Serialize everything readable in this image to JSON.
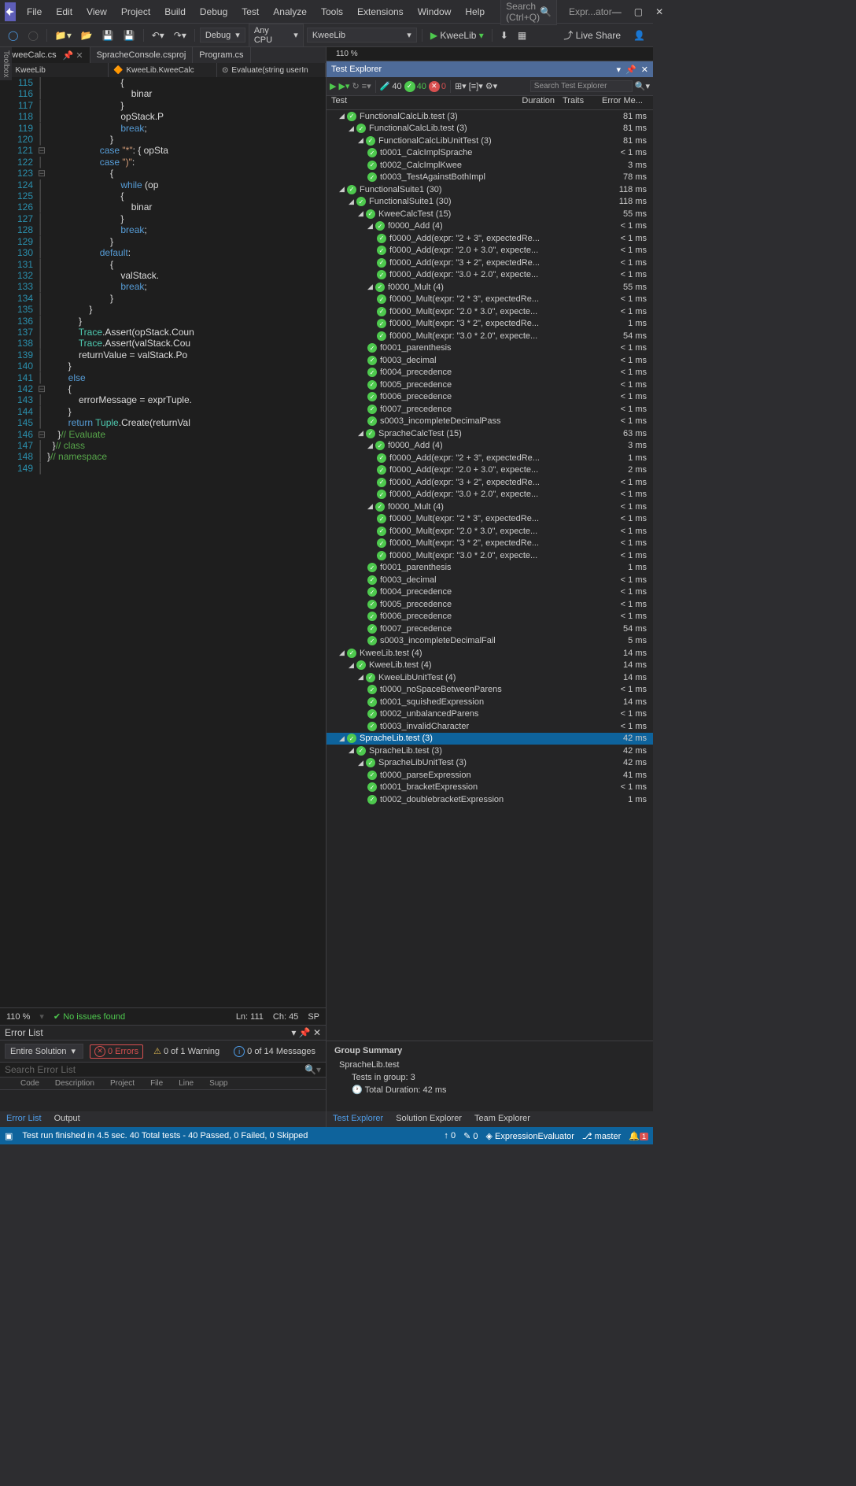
{
  "menu": [
    "File",
    "Edit",
    "View",
    "Project",
    "Build",
    "Debug",
    "Test",
    "Analyze",
    "Tools",
    "Extensions",
    "Window",
    "Help"
  ],
  "searchPlaceholder": "Search (Ctrl+Q)",
  "windowTitle": "Expr...ator",
  "toolbar": {
    "config": "Debug",
    "platform": "Any CPU",
    "project": "KweeLib",
    "run": "KweeLib",
    "liveShare": "Live Share"
  },
  "tabs": [
    {
      "label": "KweeCalc.cs",
      "active": true
    },
    {
      "label": "SpracheConsole.csproj",
      "active": false
    },
    {
      "label": "Program.cs",
      "active": false
    }
  ],
  "nav": {
    "ns": "KweeLib",
    "cls": "KweeLib.KweeCalc",
    "mth": "Evaluate(string userIn"
  },
  "lines": [
    115,
    116,
    117,
    118,
    119,
    120,
    121,
    122,
    123,
    124,
    125,
    126,
    127,
    128,
    129,
    130,
    131,
    132,
    133,
    134,
    135,
    136,
    137,
    138,
    139,
    140,
    141,
    142,
    143,
    144,
    145,
    146,
    147,
    148,
    149
  ],
  "editorStatus": {
    "zoom": "110 %",
    "issues": "No issues found",
    "ln": "Ln: 111",
    "ch": "Ch: 45",
    "spc": "SP",
    "zoom2": "110 %"
  },
  "errorList": {
    "title": "Error List",
    "scope": "Entire Solution",
    "errors": "0 Errors",
    "warnings": "0 of 1 Warning",
    "messages": "0 of 14 Messages",
    "search": "Search Error List",
    "cols": [
      "",
      "Code",
      "Description",
      "Project",
      "File",
      "Line",
      "Supp"
    ]
  },
  "bottomTabs": {
    "errorList": "Error List",
    "output": "Output"
  },
  "te": {
    "title": "Test Explorer",
    "all": "40",
    "pass": "40",
    "fail": "0",
    "search": "Search Test Explorer",
    "cols": [
      "Test",
      "Duration",
      "Traits",
      "Error Me..."
    ],
    "summary": {
      "title": "Group Summary",
      "group": "SpracheLib.test",
      "count": "Tests in group:  3",
      "duration": "Total Duration:  42  ms"
    }
  },
  "teBottom": {
    "te": "Test Explorer",
    "se": "Solution Explorer",
    "tex": "Team Explorer"
  },
  "tree": [
    {
      "d": 0,
      "n": "FunctionalCalcLib.test (3)",
      "t": "81 ms"
    },
    {
      "d": 1,
      "n": "FunctionalCalcLib.test (3)",
      "t": "81 ms"
    },
    {
      "d": 2,
      "n": "FunctionalCalcLibUnitTest (3)",
      "t": "81 ms"
    },
    {
      "d": 3,
      "n": "t0001_CalcImplSprache",
      "t": "< 1 ms",
      "leaf": true
    },
    {
      "d": 3,
      "n": "t0002_CalcImplKwee",
      "t": "3 ms",
      "leaf": true
    },
    {
      "d": 3,
      "n": "t0003_TestAgainstBothImpl",
      "t": "78 ms",
      "leaf": true
    },
    {
      "d": 0,
      "n": "FunctionalSuite1 (30)",
      "t": "118 ms"
    },
    {
      "d": 1,
      "n": "FunctionalSuite1 (30)",
      "t": "118 ms"
    },
    {
      "d": 2,
      "n": "KweeCalcTest (15)",
      "t": "55 ms"
    },
    {
      "d": 3,
      "n": "f0000_Add (4)",
      "t": "< 1 ms"
    },
    {
      "d": 4,
      "n": "f0000_Add(expr: \"2 + 3\", expectedRe...",
      "t": "< 1 ms",
      "leaf": true
    },
    {
      "d": 4,
      "n": "f0000_Add(expr: \"2.0 + 3.0\", expecte...",
      "t": "< 1 ms",
      "leaf": true
    },
    {
      "d": 4,
      "n": "f0000_Add(expr: \"3 + 2\", expectedRe...",
      "t": "< 1 ms",
      "leaf": true
    },
    {
      "d": 4,
      "n": "f0000_Add(expr: \"3.0 + 2.0\", expecte...",
      "t": "< 1 ms",
      "leaf": true
    },
    {
      "d": 3,
      "n": "f0000_Mult (4)",
      "t": "55 ms"
    },
    {
      "d": 4,
      "n": "f0000_Mult(expr: \"2 * 3\", expectedRe...",
      "t": "< 1 ms",
      "leaf": true
    },
    {
      "d": 4,
      "n": "f0000_Mult(expr: \"2.0 * 3.0\", expecte...",
      "t": "< 1 ms",
      "leaf": true
    },
    {
      "d": 4,
      "n": "f0000_Mult(expr: \"3 * 2\", expectedRe...",
      "t": "1 ms",
      "leaf": true
    },
    {
      "d": 4,
      "n": "f0000_Mult(expr: \"3.0 * 2.0\", expecte...",
      "t": "54 ms",
      "leaf": true
    },
    {
      "d": 3,
      "n": "f0001_parenthesis",
      "t": "< 1 ms",
      "leaf": true
    },
    {
      "d": 3,
      "n": "f0003_decimal",
      "t": "< 1 ms",
      "leaf": true
    },
    {
      "d": 3,
      "n": "f0004_precedence",
      "t": "< 1 ms",
      "leaf": true
    },
    {
      "d": 3,
      "n": "f0005_precedence",
      "t": "< 1 ms",
      "leaf": true
    },
    {
      "d": 3,
      "n": "f0006_precedence",
      "t": "< 1 ms",
      "leaf": true
    },
    {
      "d": 3,
      "n": "f0007_precedence",
      "t": "< 1 ms",
      "leaf": true
    },
    {
      "d": 3,
      "n": "s0003_incompleteDecimalPass",
      "t": "< 1 ms",
      "leaf": true
    },
    {
      "d": 2,
      "n": "SpracheCalcTest (15)",
      "t": "63 ms"
    },
    {
      "d": 3,
      "n": "f0000_Add (4)",
      "t": "3 ms"
    },
    {
      "d": 4,
      "n": "f0000_Add(expr: \"2 + 3\", expectedRe...",
      "t": "1 ms",
      "leaf": true
    },
    {
      "d": 4,
      "n": "f0000_Add(expr: \"2.0 + 3.0\", expecte...",
      "t": "2 ms",
      "leaf": true
    },
    {
      "d": 4,
      "n": "f0000_Add(expr: \"3 + 2\", expectedRe...",
      "t": "< 1 ms",
      "leaf": true
    },
    {
      "d": 4,
      "n": "f0000_Add(expr: \"3.0 + 2.0\", expecte...",
      "t": "< 1 ms",
      "leaf": true
    },
    {
      "d": 3,
      "n": "f0000_Mult (4)",
      "t": "< 1 ms"
    },
    {
      "d": 4,
      "n": "f0000_Mult(expr: \"2 * 3\", expectedRe...",
      "t": "< 1 ms",
      "leaf": true
    },
    {
      "d": 4,
      "n": "f0000_Mult(expr: \"2.0 * 3.0\", expecte...",
      "t": "< 1 ms",
      "leaf": true
    },
    {
      "d": 4,
      "n": "f0000_Mult(expr: \"3 * 2\", expectedRe...",
      "t": "< 1 ms",
      "leaf": true
    },
    {
      "d": 4,
      "n": "f0000_Mult(expr: \"3.0 * 2.0\", expecte...",
      "t": "< 1 ms",
      "leaf": true
    },
    {
      "d": 3,
      "n": "f0001_parenthesis",
      "t": "1 ms",
      "leaf": true
    },
    {
      "d": 3,
      "n": "f0003_decimal",
      "t": "< 1 ms",
      "leaf": true
    },
    {
      "d": 3,
      "n": "f0004_precedence",
      "t": "< 1 ms",
      "leaf": true
    },
    {
      "d": 3,
      "n": "f0005_precedence",
      "t": "< 1 ms",
      "leaf": true
    },
    {
      "d": 3,
      "n": "f0006_precedence",
      "t": "< 1 ms",
      "leaf": true
    },
    {
      "d": 3,
      "n": "f0007_precedence",
      "t": "54 ms",
      "leaf": true
    },
    {
      "d": 3,
      "n": "s0003_incompleteDecimalFail",
      "t": "5 ms",
      "leaf": true
    },
    {
      "d": 0,
      "n": "KweeLib.test (4)",
      "t": "14 ms"
    },
    {
      "d": 1,
      "n": "KweeLib.test (4)",
      "t": "14 ms"
    },
    {
      "d": 2,
      "n": "KweeLibUnitTest (4)",
      "t": "14 ms"
    },
    {
      "d": 3,
      "n": "t0000_noSpaceBetweenParens",
      "t": "< 1 ms",
      "leaf": true
    },
    {
      "d": 3,
      "n": "t0001_squishedExpression",
      "t": "14 ms",
      "leaf": true
    },
    {
      "d": 3,
      "n": "t0002_unbalancedParens",
      "t": "< 1 ms",
      "leaf": true
    },
    {
      "d": 3,
      "n": "t0003_invalidCharacter",
      "t": "< 1 ms",
      "leaf": true
    },
    {
      "d": 0,
      "n": "SpracheLib.test (3)",
      "t": "42 ms",
      "sel": true
    },
    {
      "d": 1,
      "n": "SpracheLib.test (3)",
      "t": "42 ms"
    },
    {
      "d": 2,
      "n": "SpracheLibUnitTest (3)",
      "t": "42 ms"
    },
    {
      "d": 3,
      "n": "t0000_parseExpression",
      "t": "41 ms",
      "leaf": true
    },
    {
      "d": 3,
      "n": "t0001_bracketExpression",
      "t": "< 1 ms",
      "leaf": true
    },
    {
      "d": 3,
      "n": "t0002_doublebracketExpression",
      "t": "1 ms",
      "leaf": true
    }
  ],
  "status": {
    "msg": "Test run finished in 4.5 sec. 40 Total tests - 40 Passed, 0 Failed, 0 Skipped",
    "up": "0",
    "pen": "0",
    "proj": "ExpressionEvaluator",
    "branch": "master",
    "notif": "1"
  },
  "toolbox": "Toolbox"
}
